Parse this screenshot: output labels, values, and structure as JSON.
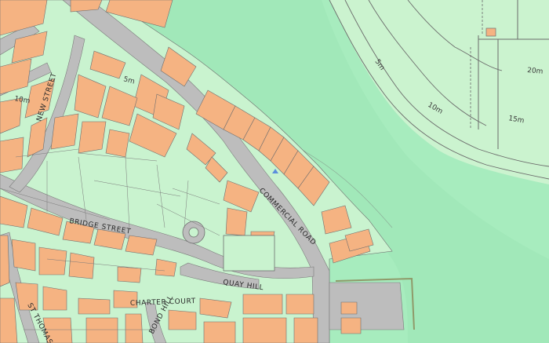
{
  "map": {
    "colors": {
      "sea": "#a7ecbe",
      "land_green": "#c9f3cf",
      "building": "#f5b382",
      "road": "#bdbdbd",
      "outline": "#6e6e6e"
    },
    "street_labels": {
      "new_street": "NEW STREET",
      "commercial_road": "COMMERCIAL ROAD",
      "bridge_street": "BRIDGE STREET",
      "quay_hill": "QUAY HILL",
      "charter_court": "CHARTER COURT",
      "st_thomas": "ST THOMAS",
      "bond_hill": "BOND HILL"
    },
    "contour_labels": {
      "c_5m_land": "5m",
      "c_10m_land": "10m",
      "c_5m_hill": "5m",
      "c_10m_hill": "10m",
      "c_15m_hill": "15m",
      "c_20m_hill": "20m"
    }
  }
}
